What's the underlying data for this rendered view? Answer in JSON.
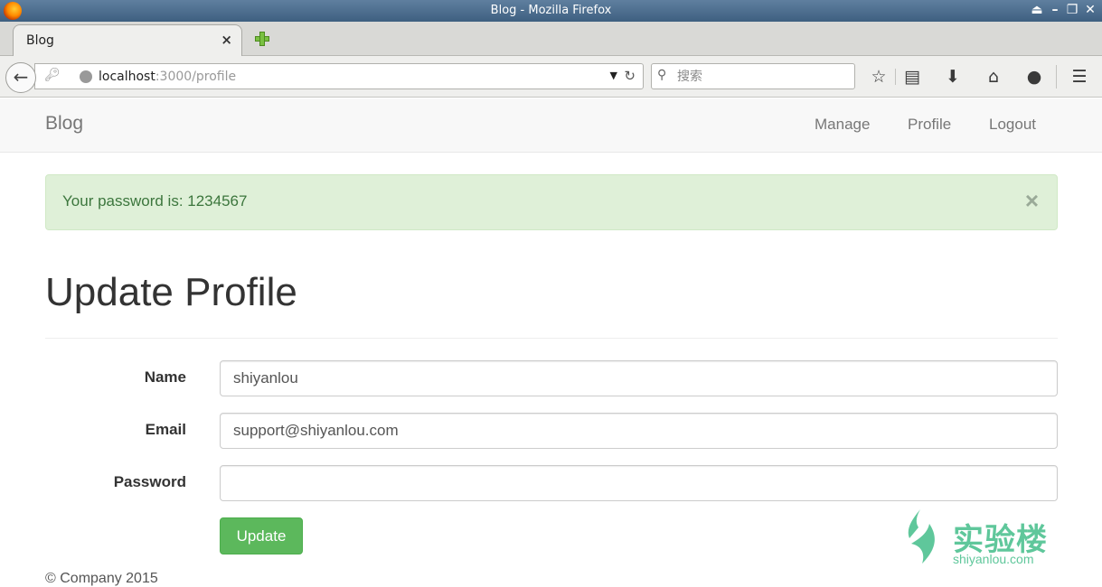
{
  "browser": {
    "window_title": "Blog - Mozilla Firefox",
    "tab_title": "Blog",
    "tab_close": "×",
    "url_host": "localhost",
    "url_path": ":3000/profile",
    "search_placeholder": "搜索"
  },
  "site": {
    "brand": "Blog",
    "nav": {
      "manage": "Manage",
      "profile": "Profile",
      "logout": "Logout"
    }
  },
  "alert": {
    "message": "Your password is: 1234567",
    "close": "×"
  },
  "page": {
    "title": "Update Profile"
  },
  "form": {
    "name_label": "Name",
    "name_value": "shiyanlou",
    "email_label": "Email",
    "email_value": "support@shiyanlou.com",
    "password_label": "Password",
    "password_value": "",
    "submit": "Update"
  },
  "footer": {
    "text": "© Company 2015"
  },
  "watermark": {
    "name": "实验楼",
    "site": "shiyanlou.com"
  },
  "colors": {
    "success_bg": "#dff0d8",
    "success_text": "#3c763d",
    "button": "#5cb85c",
    "watermark": "#5fc79b"
  }
}
